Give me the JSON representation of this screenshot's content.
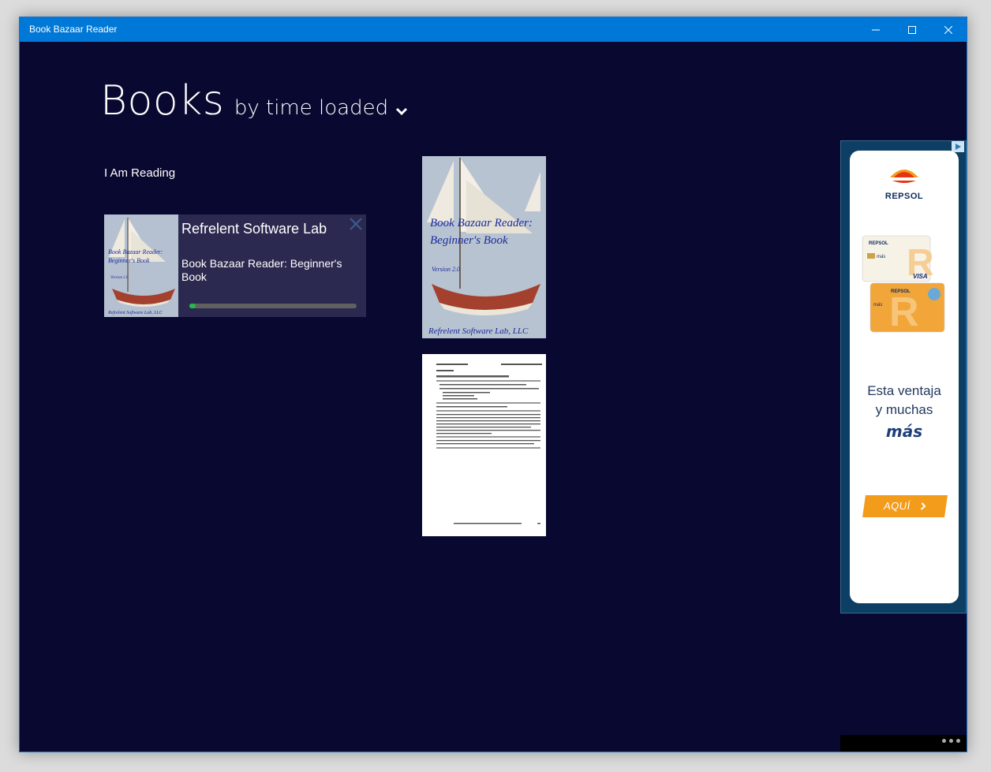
{
  "window": {
    "title": "Book Bazaar Reader",
    "accent_color": "#0078d7",
    "background_color": "#090830"
  },
  "header": {
    "title": "Books",
    "sort_label": "by time loaded",
    "sort_icon": "chevron-down-icon"
  },
  "reading": {
    "section_label": "I Am Reading",
    "book": {
      "publisher": "Refrelent Software Lab",
      "title": "Book Bazaar Reader: Beginner's Book",
      "progress": 0.04,
      "progress_color": "#26b84a",
      "cover": {
        "title_line1": "Book Bazaar Reader:",
        "title_line2": "Beginner's Book",
        "version": "Version 2.0",
        "publisher": "Refrelent Software Lab, LLC"
      }
    }
  },
  "library": {
    "books": [
      {
        "kind": "cover",
        "title_line1": "Book Bazaar Reader:",
        "title_line2": "Beginner's Book",
        "version": "Version 2.0",
        "publisher": "Refrelent Software Lab, LLC"
      },
      {
        "kind": "document-page"
      }
    ]
  },
  "ad": {
    "brand": "REPSOL",
    "headline_line1": "Esta ventaja",
    "headline_line2": "y muchas",
    "headline_emphasis": "más",
    "cta": "AQUÍ",
    "card_labels": [
      "REPSOL",
      "más",
      "VISA",
      "REPSOL",
      "más"
    ]
  },
  "appbar": {
    "more_icon": "ellipsis-icon"
  }
}
